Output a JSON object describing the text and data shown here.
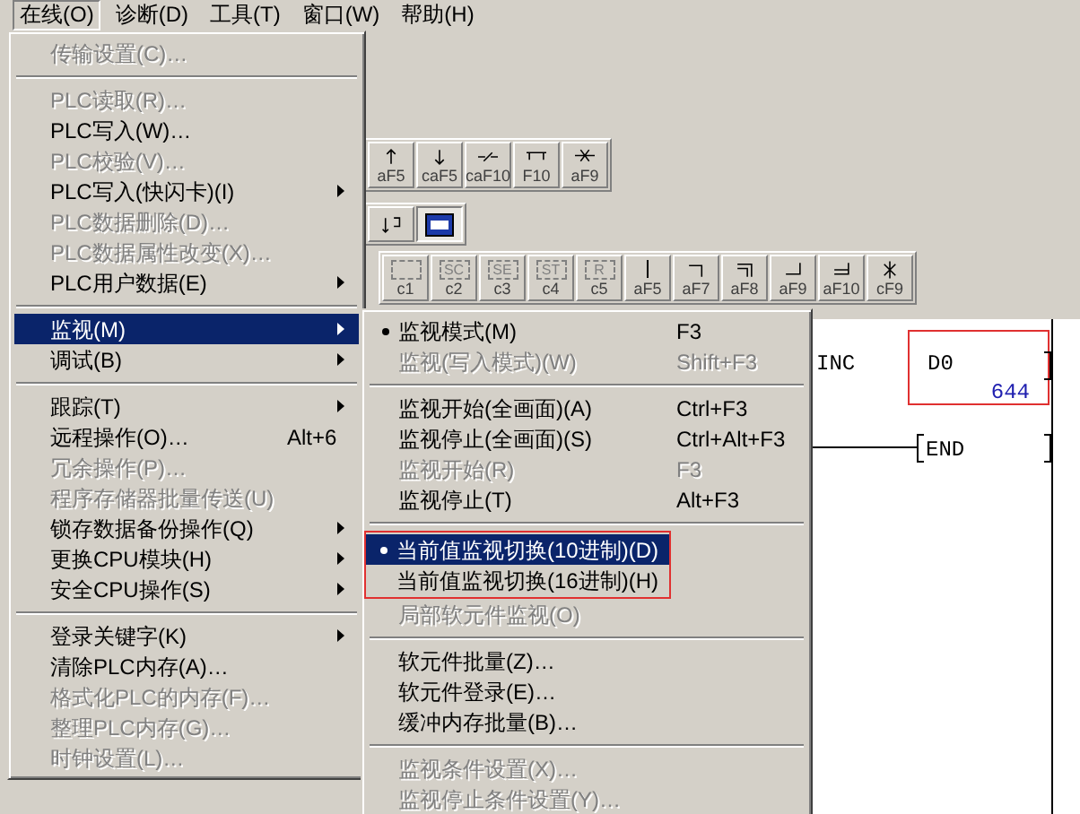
{
  "menubar": [
    {
      "label": "在线(O)",
      "selected": true
    },
    {
      "label": "诊断(D)",
      "selected": false
    },
    {
      "label": "工具(T)",
      "selected": false
    },
    {
      "label": "窗口(W)",
      "selected": false
    },
    {
      "label": "帮助(H)",
      "selected": false
    }
  ],
  "toolbars": [
    {
      "buttons": [
        {
          "kind": "up",
          "key": "aF5",
          "selected": false
        },
        {
          "kind": "down",
          "key": "caF5",
          "selected": false
        },
        {
          "kind": "contact",
          "key": "caF10",
          "selected": false
        },
        {
          "kind": "hline",
          "key": "F10",
          "selected": false
        },
        {
          "kind": "cross-line",
          "key": "aF9",
          "selected": false
        }
      ]
    },
    {
      "buttons": [
        {
          "kind": "arrows",
          "selected": false
        },
        {
          "kind": "monitor",
          "selected": true
        }
      ]
    },
    {
      "buttons": [
        {
          "kind": "box",
          "key": "c1",
          "selected": false
        },
        {
          "kind": "box",
          "key": "c2",
          "glyph": "SC",
          "selected": false
        },
        {
          "kind": "box",
          "key": "c3",
          "glyph": "SE",
          "selected": false
        },
        {
          "kind": "box",
          "key": "c4",
          "glyph": "ST",
          "selected": false
        },
        {
          "kind": "box",
          "key": "c5",
          "glyph": "R",
          "selected": false
        },
        {
          "kind": "vline",
          "key": "aF5",
          "selected": false
        },
        {
          "kind": "corner",
          "key": "aF7",
          "selected": false
        },
        {
          "kind": "double-corner",
          "key": "aF8",
          "selected": false
        },
        {
          "kind": "bottom-corner",
          "key": "aF9",
          "selected": false
        },
        {
          "kind": "double-bottom",
          "key": "aF10",
          "selected": false
        },
        {
          "kind": "cross",
          "key": "cF9",
          "selected": false
        }
      ]
    }
  ],
  "ladder": {
    "rungs": [
      {
        "kind": "instruction",
        "instruction": "INC",
        "operand": "D0",
        "value": "644",
        "highlighted": true
      },
      {
        "kind": "end",
        "instruction": "END"
      }
    ]
  },
  "online_menu": {
    "items": [
      {
        "kind": "item",
        "label": "传输设置(C)…",
        "disabled": true,
        "selected": false,
        "submenu": false
      },
      {
        "kind": "separator"
      },
      {
        "kind": "item",
        "label": "PLC读取(R)…",
        "disabled": true,
        "selected": false,
        "submenu": false
      },
      {
        "kind": "item",
        "label": "PLC写入(W)…",
        "disabled": false,
        "selected": false,
        "submenu": false
      },
      {
        "kind": "item",
        "label": "PLC校验(V)…",
        "disabled": true,
        "selected": false,
        "submenu": false
      },
      {
        "kind": "item",
        "label": "PLC写入(快闪卡)(I)",
        "disabled": false,
        "selected": false,
        "submenu": true
      },
      {
        "kind": "item",
        "label": "PLC数据删除(D)…",
        "disabled": true,
        "selected": false,
        "submenu": false
      },
      {
        "kind": "item",
        "label": "PLC数据属性改变(X)…",
        "disabled": true,
        "selected": false,
        "submenu": false
      },
      {
        "kind": "item",
        "label": "PLC用户数据(E)",
        "disabled": false,
        "selected": false,
        "submenu": true
      },
      {
        "kind": "separator"
      },
      {
        "kind": "item",
        "label": "监视(M)",
        "disabled": false,
        "selected": true,
        "submenu": true
      },
      {
        "kind": "item",
        "label": "调试(B)",
        "disabled": false,
        "selected": false,
        "submenu": true
      },
      {
        "kind": "separator"
      },
      {
        "kind": "item",
        "label": "跟踪(T)",
        "disabled": false,
        "selected": false,
        "submenu": true
      },
      {
        "kind": "item",
        "label": "远程操作(O)…",
        "shortcut": "Alt+6",
        "disabled": false,
        "selected": false,
        "submenu": false
      },
      {
        "kind": "item",
        "label": "冗余操作(P)…",
        "disabled": true,
        "selected": false,
        "submenu": false
      },
      {
        "kind": "item",
        "label": "程序存储器批量传送(U)",
        "disabled": true,
        "selected": false,
        "submenu": false
      },
      {
        "kind": "item",
        "label": "锁存数据备份操作(Q)",
        "disabled": false,
        "selected": false,
        "submenu": true
      },
      {
        "kind": "item",
        "label": "更换CPU模块(H)",
        "disabled": false,
        "selected": false,
        "submenu": true
      },
      {
        "kind": "item",
        "label": "安全CPU操作(S)",
        "disabled": false,
        "selected": false,
        "submenu": true
      },
      {
        "kind": "separator"
      },
      {
        "kind": "item",
        "label": "登录关键字(K)",
        "disabled": false,
        "selected": false,
        "submenu": true
      },
      {
        "kind": "item",
        "label": "清除PLC内存(A)…",
        "disabled": false,
        "selected": false,
        "submenu": false
      },
      {
        "kind": "item",
        "label": "格式化PLC的内存(F)…",
        "disabled": true,
        "selected": false,
        "submenu": false
      },
      {
        "kind": "item",
        "label": "整理PLC内存(G)…",
        "disabled": true,
        "selected": false,
        "submenu": false
      },
      {
        "kind": "item",
        "label": "时钟设置(L)…",
        "disabled": true,
        "selected": false,
        "submenu": false
      }
    ]
  },
  "monitor_submenu": {
    "items": [
      {
        "kind": "item",
        "label": "监视模式(M)",
        "shortcut": "F3",
        "checked": true,
        "disabled": false,
        "selected": false,
        "highlighted": false
      },
      {
        "kind": "item",
        "label": "监视(写入模式)(W)",
        "shortcut": "Shift+F3",
        "checked": false,
        "disabled": true,
        "selected": false,
        "highlighted": false
      },
      {
        "kind": "separator"
      },
      {
        "kind": "item",
        "label": "监视开始(全画面)(A)",
        "shortcut": "Ctrl+F3",
        "checked": false,
        "disabled": false,
        "selected": false,
        "highlighted": false
      },
      {
        "kind": "item",
        "label": "监视停止(全画面)(S)",
        "shortcut": "Ctrl+Alt+F3",
        "checked": false,
        "disabled": false,
        "selected": false,
        "highlighted": false
      },
      {
        "kind": "item",
        "label": "监视开始(R)",
        "shortcut": "F3",
        "checked": false,
        "disabled": true,
        "selected": false,
        "highlighted": false
      },
      {
        "kind": "item",
        "label": "监视停止(T)",
        "shortcut": "Alt+F3",
        "checked": false,
        "disabled": false,
        "selected": false,
        "highlighted": false
      },
      {
        "kind": "separator"
      },
      {
        "kind": "item",
        "label": "当前值监视切换(10进制)(D)",
        "checked": true,
        "disabled": false,
        "selected": true,
        "highlighted": true
      },
      {
        "kind": "item",
        "label": "当前值监视切换(16进制)(H)",
        "checked": false,
        "disabled": false,
        "selected": false,
        "highlighted": true
      },
      {
        "kind": "item",
        "label": "局部软元件监视(O)",
        "checked": false,
        "disabled": true,
        "selected": false,
        "highlighted": false
      },
      {
        "kind": "separator"
      },
      {
        "kind": "item",
        "label": "软元件批量(Z)…",
        "checked": false,
        "disabled": false,
        "selected": false,
        "highlighted": false
      },
      {
        "kind": "item",
        "label": "软元件登录(E)…",
        "checked": false,
        "disabled": false,
        "selected": false,
        "highlighted": false
      },
      {
        "kind": "item",
        "label": "缓冲内存批量(B)…",
        "checked": false,
        "disabled": false,
        "selected": false,
        "highlighted": false
      },
      {
        "kind": "separator"
      },
      {
        "kind": "item",
        "label": "监视条件设置(X)…",
        "checked": false,
        "disabled": true,
        "selected": false,
        "highlighted": false
      },
      {
        "kind": "item",
        "label": "监视停止条件设置(Y)…",
        "checked": false,
        "disabled": true,
        "selected": false,
        "highlighted": false
      }
    ]
  }
}
